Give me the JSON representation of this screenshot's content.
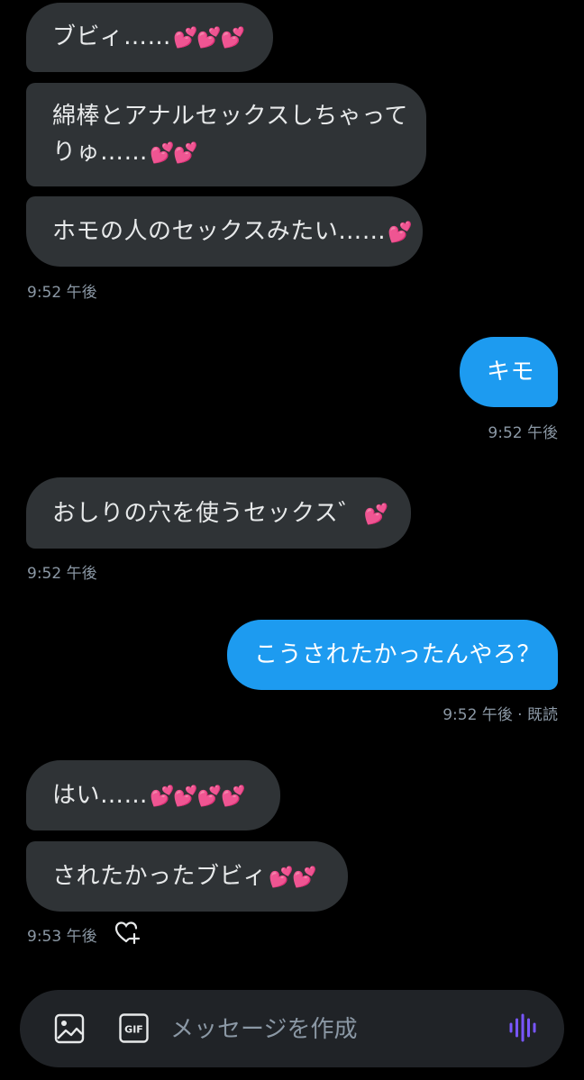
{
  "messages": [
    {
      "text": "ブビィ……",
      "hearts": "💕💕💕"
    },
    {
      "line1": "綿棒とアナルセックスしちゃって",
      "line2": "りゅ……",
      "hearts": "💕💕"
    },
    {
      "text": "ホモの人のセックスみたい……",
      "hearts": "💕"
    },
    {
      "time": "9:52 午後"
    },
    {
      "text": "キモ"
    },
    {
      "time": "9:52 午後"
    },
    {
      "text": "おしりの穴を使うセックス゛",
      "hearts": "💕"
    },
    {
      "time": "9:52 午後"
    },
    {
      "text": "こうされたかったんやろ？"
    },
    {
      "time": "9:52 午後 · 既読"
    },
    {
      "text": "はい……",
      "hearts": "💕💕💕💕"
    },
    {
      "text": "されたかったブビィ",
      "hearts": "💕💕"
    },
    {
      "time": "9:53 午後"
    }
  ],
  "composer": {
    "placeholder": "メッセージを作成",
    "gif_label": "GIF"
  },
  "colors": {
    "sent_bubble": "#1d9bf0",
    "received_bubble": "#2f3336",
    "accent_voice": "#7856ff"
  },
  "icons": [
    "heart-plus-icon",
    "image-icon",
    "gif-icon",
    "voice-wave-icon"
  ]
}
